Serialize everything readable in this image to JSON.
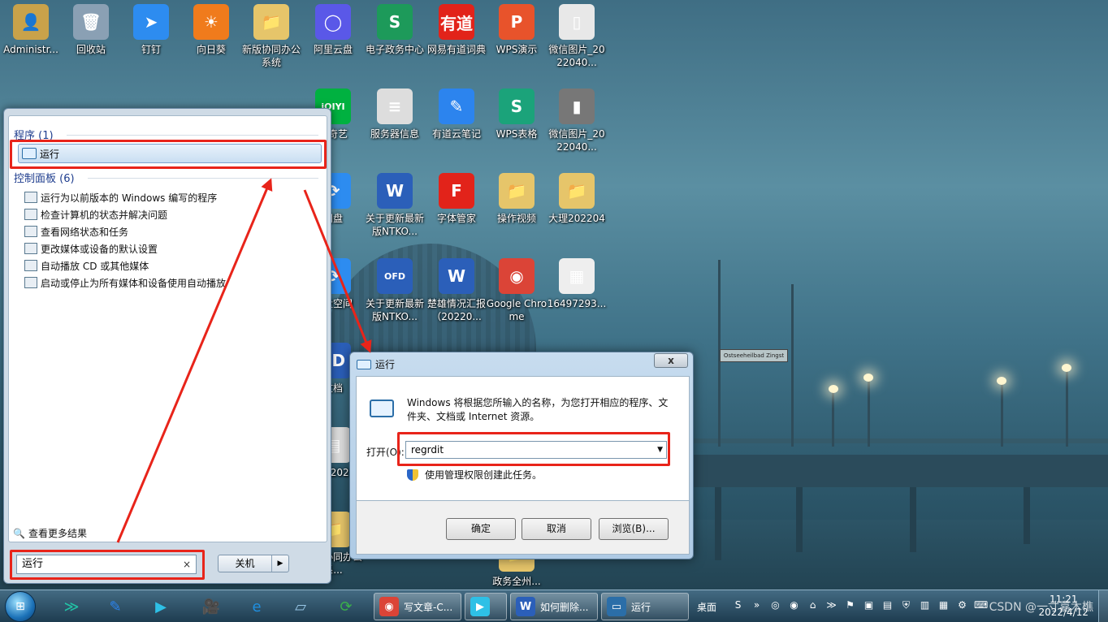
{
  "desktop_icons": [
    {
      "label": "Administr...",
      "glyph": "👤",
      "color": "#c9a24a"
    },
    {
      "label": "回收站",
      "glyph": "🗑",
      "color": "#8aa0b4"
    },
    {
      "label": "钉钉",
      "glyph": "➤",
      "color": "#2d8cf0"
    },
    {
      "label": "向日葵",
      "glyph": "☀",
      "color": "#f07b1c"
    },
    {
      "label": "新版协同办公系统",
      "glyph": "📁",
      "color": "#e6c56a"
    },
    {
      "label": "阿里云盘",
      "glyph": "◯",
      "color": "#5a58e8"
    },
    {
      "label": "电子政务中心",
      "glyph": "S",
      "color": "#1d9a5a"
    },
    {
      "label": "网易有道词典",
      "glyph": "有道",
      "color": "#e2231a"
    },
    {
      "label": "WPS演示",
      "glyph": "P",
      "color": "#e8532b"
    },
    {
      "label": "微信图片_2022040...",
      "glyph": "▯",
      "color": "#e8e8e8"
    },
    {
      "label": "爱奇艺",
      "glyph": "iQIYI",
      "color": "#00b140"
    },
    {
      "label": "服务器信息",
      "glyph": "≡",
      "color": "#dddddd"
    },
    {
      "label": "有道云笔记",
      "glyph": "✎",
      "color": "#2c84ee"
    },
    {
      "label": "WPS表格",
      "glyph": "S",
      "color": "#1ba37a"
    },
    {
      "label": "微信图片_2022040...",
      "glyph": "▮",
      "color": "#777777"
    },
    {
      "label": "网盘",
      "glyph": "⟳",
      "color": "#2d8cf0"
    },
    {
      "label": "关于更新最新版NTKO...",
      "glyph": "W",
      "color": "#2b5fb9"
    },
    {
      "label": "字体管家",
      "glyph": "F",
      "color": "#e2231a"
    },
    {
      "label": "操作视频",
      "glyph": "📁",
      "color": "#e6c56a"
    },
    {
      "label": "大理202204",
      "glyph": "📁",
      "color": "#e6c56a"
    },
    {
      "label": "网盘空间",
      "glyph": "⟳",
      "color": "#2d8cf0"
    },
    {
      "label": "关于更新最新版NTKO...",
      "glyph": "OFD",
      "color": "#2b5fb9"
    },
    {
      "label": "楚雄情况汇报（20220...",
      "glyph": "W",
      "color": "#2b5fb9"
    },
    {
      "label": "Google Chrome",
      "glyph": "◉",
      "color": "#db4437"
    },
    {
      "label": "16497293...",
      "glyph": "▦",
      "color": "#eeeeee"
    },
    {
      "label": "文档",
      "glyph": "FD",
      "color": "#2b5fb9"
    },
    {
      "label": "问题2022",
      "glyph": "▤",
      "color": "#dddddd"
    },
    {
      "label": "新版协同办公系...",
      "glyph": "📁",
      "color": "#e6c56a"
    },
    {
      "label": "政务全州...",
      "glyph": "📁",
      "color": "#e6c56a"
    }
  ],
  "wallpaper": {
    "sign_text": "Ostseeheilbad Zingst"
  },
  "start_menu": {
    "programs_header": "程序 (1)",
    "run_item": "运行",
    "control_panel_header": "控制面板 (6)",
    "control_panel_items": [
      "运行为以前版本的 Windows 编写的程序",
      "检查计算机的状态并解决问题",
      "查看网络状态和任务",
      "更改媒体或设备的默认设置",
      "自动播放 CD 或其他媒体",
      "启动或停止为所有媒体和设备使用自动播放"
    ],
    "see_more": "查看更多结果",
    "search_value": "运行",
    "search_clear": "×",
    "shutdown_label": "关机",
    "shutdown_arrow": "▶"
  },
  "run_dialog": {
    "title": "运行",
    "close": "x",
    "description": "Windows 将根据您所输入的名称，为您打开相应的程序、文件夹、文档或 Internet 资源。",
    "open_label": "打开(O):",
    "open_value": "regrdit",
    "dropdown": "▼",
    "admin_note": "使用管理权限创建此任务。",
    "buttons": {
      "ok": "确定",
      "cancel": "取消",
      "browse": "浏览(B)..."
    }
  },
  "taskbar": {
    "start_glyph": "⊞",
    "pinned": [
      {
        "glyph": "≫",
        "color": "#22c3a6"
      },
      {
        "glyph": "✎",
        "color": "#2c84ee"
      },
      {
        "glyph": "▶",
        "color": "#2ec0e6"
      },
      {
        "glyph": "🎥",
        "color": "#333333"
      },
      {
        "glyph": "e",
        "color": "#1f8fe0"
      },
      {
        "glyph": "▱",
        "color": "#99c8e8"
      },
      {
        "glyph": "⟳",
        "color": "#3ab04a"
      }
    ],
    "tasks": [
      {
        "label": "写文章-C...",
        "glyph": "◉",
        "color": "#db4437"
      },
      {
        "label": "",
        "glyph": "▶",
        "color": "#2ec0e6"
      },
      {
        "label": "如何删除...",
        "glyph": "W",
        "color": "#2b5fb9"
      },
      {
        "label": "运行",
        "glyph": "▭",
        "color": "#2b6ea8"
      }
    ],
    "desktop_label": "桌面",
    "tray_icons": [
      "S",
      "»",
      "◎",
      "◉",
      "⌂",
      "≫",
      "⚑",
      "▣",
      "▤",
      "⛨",
      "▥",
      "▦",
      "⚙",
      "⌨"
    ],
    "watermark": "CSDN @一寸嘉木樵",
    "time": "11:21",
    "date": "2022/4/12"
  }
}
